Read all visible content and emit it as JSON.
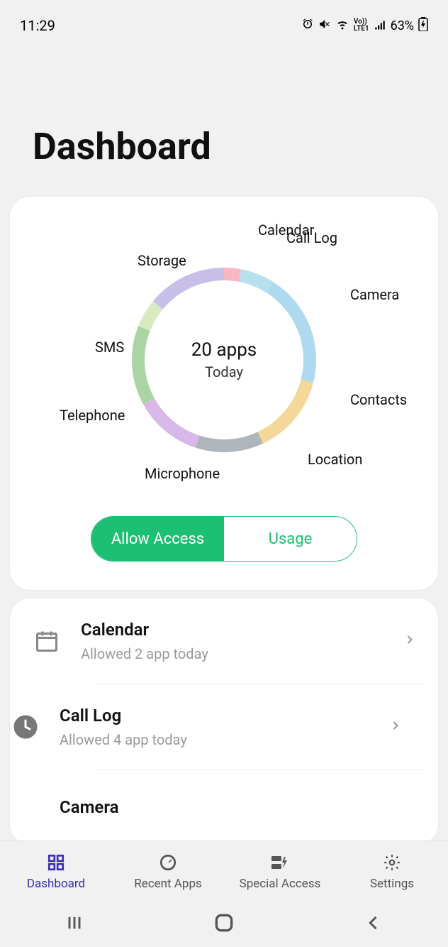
{
  "status": {
    "time": "11:29",
    "battery": "63%"
  },
  "title": "Dashboard",
  "chart_data": {
    "type": "pie",
    "title": "20 apps",
    "subtitle": "Today",
    "series": [
      {
        "name": "Calendar",
        "value": 3,
        "color": "#f6b8c3"
      },
      {
        "name": "Call Log",
        "value": 6,
        "color": "#b6e0ee"
      },
      {
        "name": "Camera",
        "value": 20,
        "color": "#aed9ee"
      },
      {
        "name": "Contacts",
        "value": 14,
        "color": "#f6d79a"
      },
      {
        "name": "Location",
        "value": 12,
        "color": "#b0b5bb"
      },
      {
        "name": "Microphone",
        "value": 12,
        "color": "#d8b8e8"
      },
      {
        "name": "Telephone",
        "value": 14,
        "color": "#aad4a3"
      },
      {
        "name": "SMS",
        "value": 5,
        "color": "#d9e9c0"
      },
      {
        "name": "Storage",
        "value": 14,
        "color": "#c8bfe8"
      }
    ]
  },
  "toggle": {
    "allow": "Allow Access",
    "usage": "Usage",
    "active": "allow"
  },
  "list": [
    {
      "icon": "calendar-icon",
      "title": "Calendar",
      "sub": "Allowed 2 app today"
    },
    {
      "icon": "clock-icon",
      "title": "Call Log",
      "sub": "Allowed 4 app today"
    },
    {
      "icon": "camera-icon",
      "title": "Camera",
      "sub": ""
    }
  ],
  "nav": {
    "items": [
      {
        "label": "Dashboard",
        "icon": "dashboard-icon",
        "active": true
      },
      {
        "label": "Recent Apps",
        "icon": "recent-icon",
        "active": false
      },
      {
        "label": "Special Access",
        "icon": "special-icon",
        "active": false
      },
      {
        "label": "Settings",
        "icon": "settings-icon",
        "active": false
      }
    ]
  }
}
